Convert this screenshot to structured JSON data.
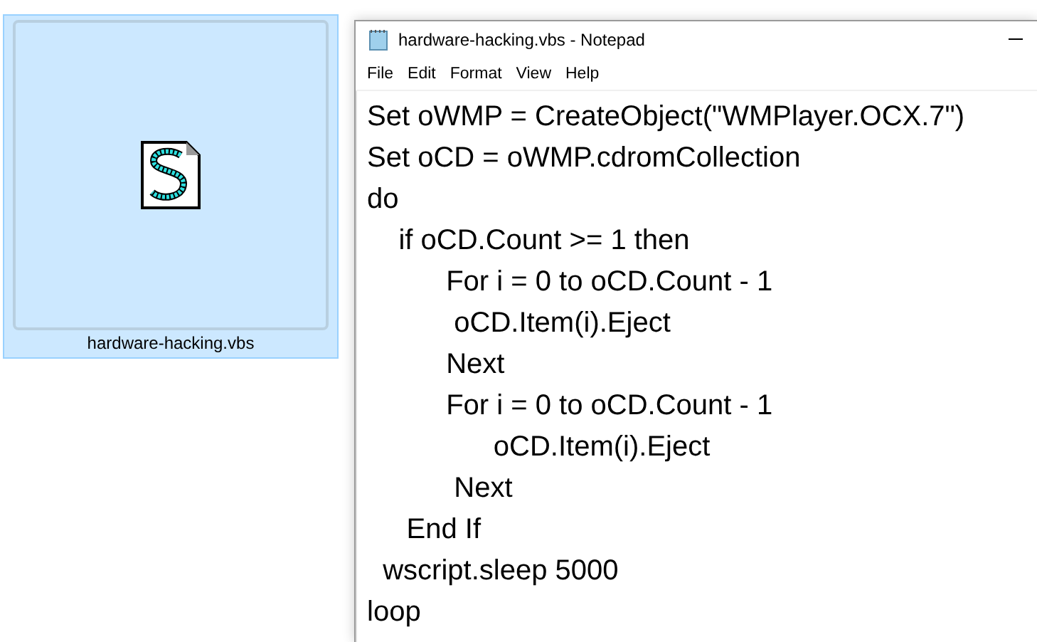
{
  "file_tile": {
    "label": "hardware-hacking.vbs",
    "selected": true
  },
  "window": {
    "title": "hardware-hacking.vbs - Notepad"
  },
  "menu": [
    "File",
    "Edit",
    "Format",
    "View",
    "Help"
  ],
  "code_lines": [
    "Set oWMP = CreateObject(\"WMPlayer.OCX.7\")",
    "Set oCD = oWMP.cdromCollection",
    "do",
    "    if oCD.Count >= 1 then",
    "          For i = 0 to oCD.Count - 1",
    "           oCD.Item(i).Eject",
    "          Next",
    "          For i = 0 to oCD.Count - 1",
    "                oCD.Item(i).Eject",
    "           Next",
    "     End If",
    "  wscript.sleep 5000",
    "loop"
  ]
}
